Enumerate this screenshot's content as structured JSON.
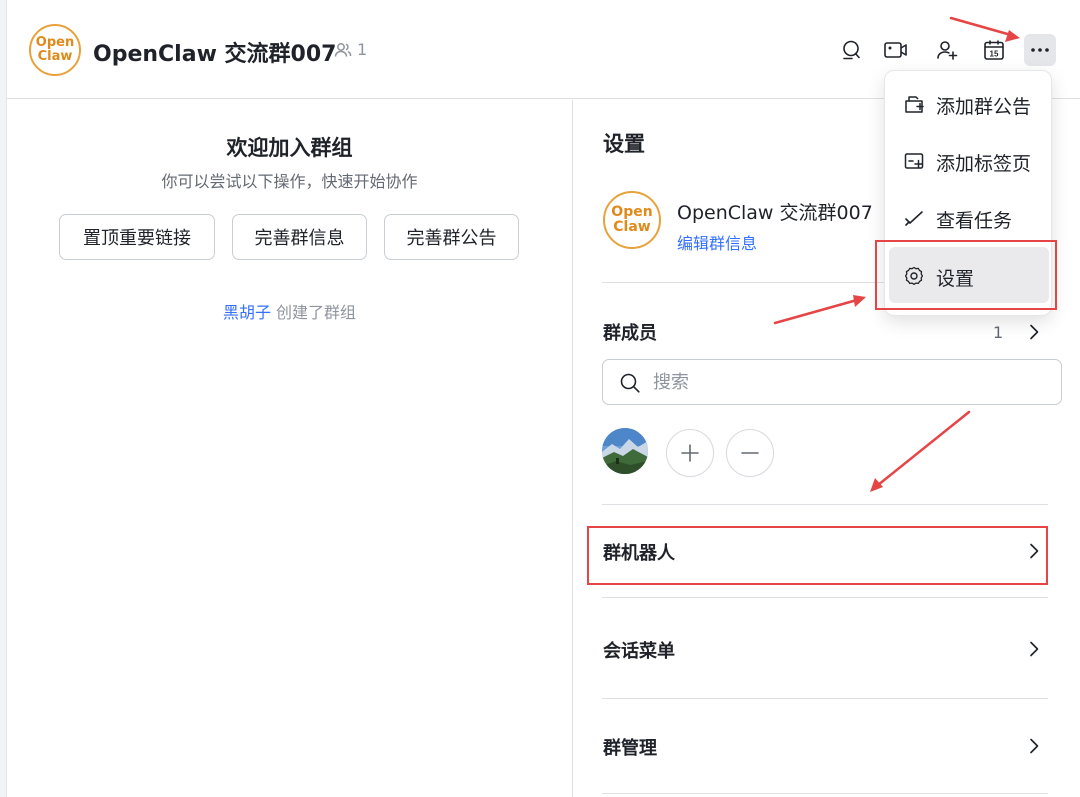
{
  "header": {
    "logo_line1": "Open",
    "logo_line2": "Claw",
    "title": "OpenClaw 交流群007",
    "member_count": "1",
    "icons": [
      "search-chat-icon",
      "video-icon",
      "add-member-icon",
      "calendar-icon",
      "more-icon"
    ],
    "calendar_day": "15"
  },
  "welcome": {
    "title": "欢迎加入群组",
    "subtitle": "你可以尝试以下操作，快速开始协作",
    "buttons": [
      "置顶重要链接",
      "完善群信息",
      "完善群公告"
    ],
    "creator": "黑胡子",
    "created_text": " 创建了群组"
  },
  "settings": {
    "title": "设置",
    "logo_line1": "Open",
    "logo_line2": "Claw",
    "group_name": "OpenClaw 交流群007",
    "edit_link": "编辑群信息",
    "members_title": "群成员",
    "members_count": "1",
    "search_placeholder": "搜索",
    "rows": [
      "群机器人",
      "会话菜单",
      "群管理"
    ]
  },
  "menu": {
    "items": [
      {
        "label": "添加群公告",
        "icon": "announcement-icon"
      },
      {
        "label": "添加标签页",
        "icon": "add-tab-icon"
      },
      {
        "label": "查看任务",
        "icon": "task-icon"
      },
      {
        "label": "设置",
        "icon": "gear-icon"
      }
    ],
    "active_index": 3
  },
  "colors": {
    "accent": "#3370ff",
    "logo": "#e08a1c",
    "annotation": "#e64545"
  }
}
